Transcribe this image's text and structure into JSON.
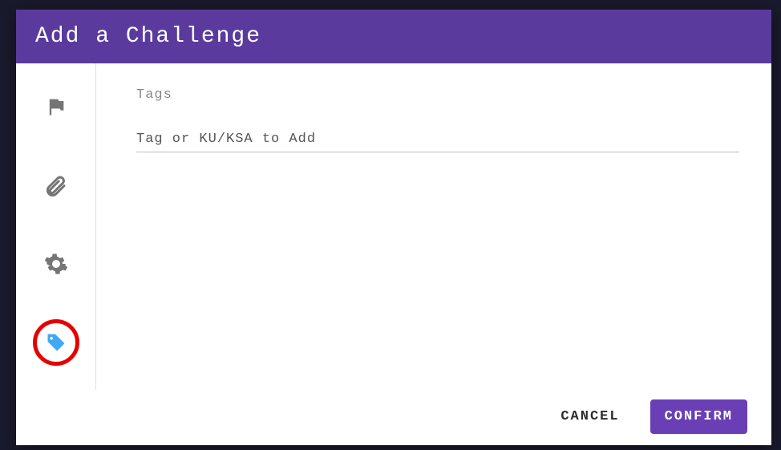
{
  "dialog": {
    "title": "Add a Challenge"
  },
  "sidebar": {
    "items": [
      {
        "name": "flag-icon",
        "active": false
      },
      {
        "name": "paperclip-icon",
        "active": false
      },
      {
        "name": "gear-icon",
        "active": false
      },
      {
        "name": "tag-icon",
        "active": true
      }
    ]
  },
  "content": {
    "section_label": "Tags",
    "tag_input_placeholder": "Tag or KU/KSA to Add",
    "tag_input_value": ""
  },
  "footer": {
    "cancel_label": "CANCEL",
    "confirm_label": "CONFIRM"
  },
  "colors": {
    "header_bg": "#5b3a9e",
    "confirm_bg": "#6a3fb5",
    "active_ring": "#e60000",
    "active_tag": "#3fa9f5",
    "icon_grey": "#757575"
  }
}
